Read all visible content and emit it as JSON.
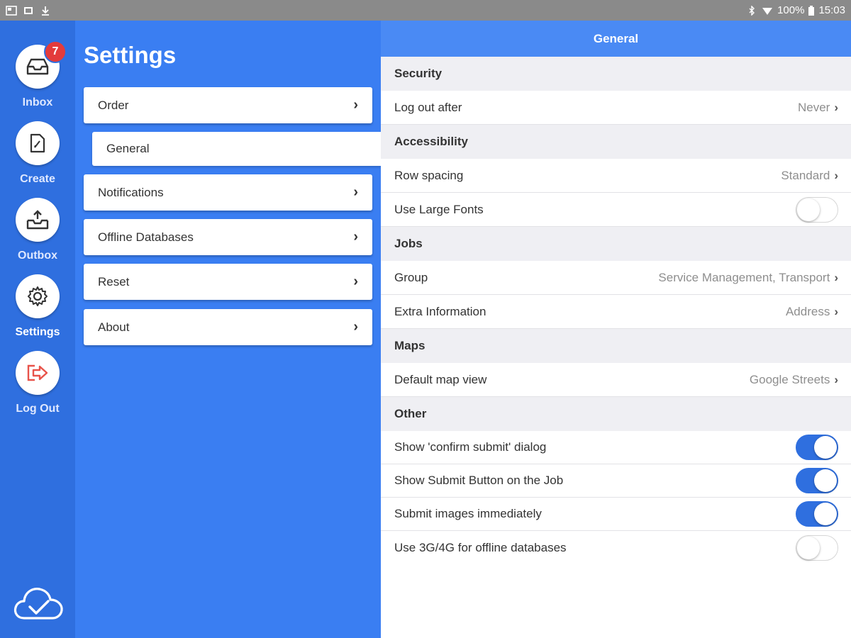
{
  "status_bar": {
    "battery": "100%",
    "time": "15:03"
  },
  "rail": {
    "items": [
      {
        "label": "Inbox",
        "icon": "inbox-icon",
        "badge": "7"
      },
      {
        "label": "Create",
        "icon": "create-icon"
      },
      {
        "label": "Outbox",
        "icon": "outbox-icon"
      },
      {
        "label": "Settings",
        "icon": "gear-icon",
        "active": true
      },
      {
        "label": "Log Out",
        "icon": "logout-icon"
      }
    ],
    "sync_icon": "cloud-check-icon"
  },
  "menu": {
    "title": "Settings",
    "items": [
      {
        "label": "Order"
      },
      {
        "label": "General",
        "selected": true
      },
      {
        "label": "Notifications"
      },
      {
        "label": "Offline Databases"
      },
      {
        "label": "Reset"
      },
      {
        "label": "About"
      }
    ]
  },
  "panel": {
    "title": "General",
    "sections": [
      {
        "title": "Security",
        "rows": [
          {
            "label": "Log out after",
            "value": "Never"
          }
        ]
      },
      {
        "title": "Accessibility",
        "rows": [
          {
            "label": "Row spacing",
            "value": "Standard"
          },
          {
            "label": "Use Large Fonts",
            "toggle": false
          }
        ]
      },
      {
        "title": "Jobs",
        "rows": [
          {
            "label": "Group",
            "value": "Service Management, Transport"
          },
          {
            "label": "Extra Information",
            "value": "Address"
          }
        ]
      },
      {
        "title": "Maps",
        "rows": [
          {
            "label": "Default map view",
            "value": "Google Streets"
          }
        ]
      },
      {
        "title": "Other",
        "rows": [
          {
            "label": "Show 'confirm submit' dialog",
            "toggle": true
          },
          {
            "label": "Show Submit Button on the Job",
            "toggle": true
          },
          {
            "label": "Submit images immediately",
            "toggle": true
          },
          {
            "label": "Use 3G/4G for offline databases",
            "toggle": false
          }
        ]
      }
    ]
  },
  "colors": {
    "rail": "#2f6fdf",
    "menu": "#3a7ef2",
    "header": "#4a8af4",
    "toggle_on": "#2f6fdf",
    "badge": "#e33b3b"
  }
}
